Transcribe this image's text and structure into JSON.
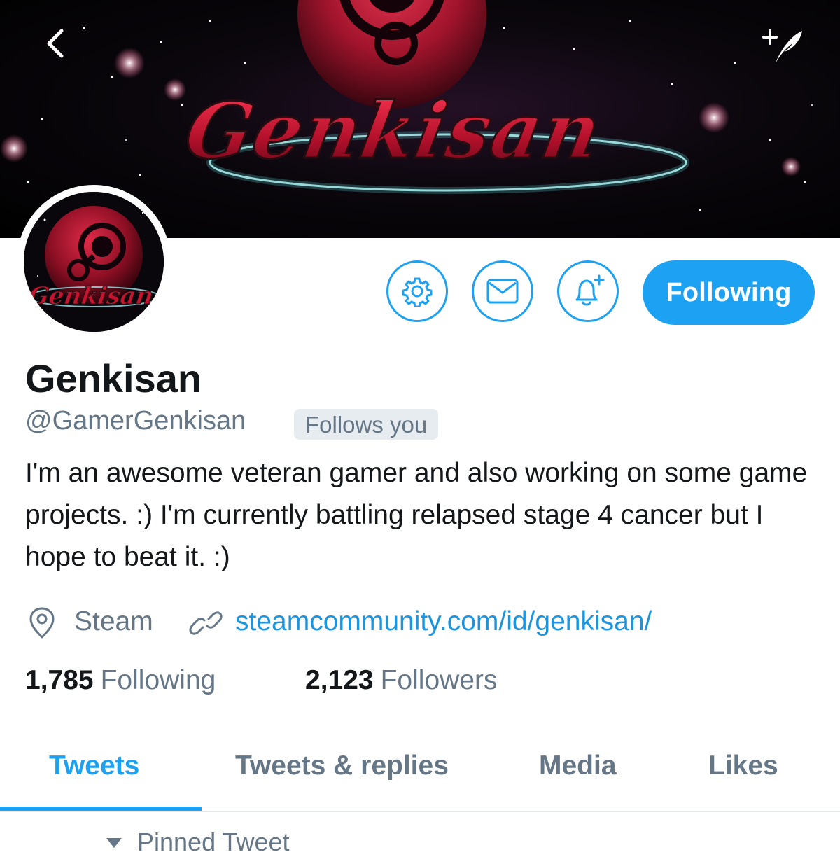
{
  "banner": {
    "logo_text": "Genkisan"
  },
  "avatar": {
    "logo_text": "Genkisan"
  },
  "actions": {
    "following_label": "Following"
  },
  "profile": {
    "name": "Genkisan",
    "handle": "@GamerGenkisan",
    "follows_you": "Follows you",
    "bio": "I'm an awesome veteran gamer and also working on some game projects. :) I'm currently battling relapsed stage 4 cancer but I hope to beat it. :)",
    "location": "Steam",
    "website": "steamcommunity.com/id/genkisan/"
  },
  "stats": {
    "following_count": "1,785",
    "following_label": "Following",
    "followers_count": "2,123",
    "followers_label": "Followers"
  },
  "tabs": [
    {
      "label": "Tweets",
      "active": true
    },
    {
      "label": "Tweets & replies",
      "active": false
    },
    {
      "label": "Media",
      "active": false
    },
    {
      "label": "Likes",
      "active": false
    }
  ],
  "pinned_label": "Pinned Tweet",
  "colors": {
    "accent": "#1da1f2",
    "link": "#1b95e0",
    "secondary_text": "#657786",
    "primary_text": "#14171a"
  }
}
